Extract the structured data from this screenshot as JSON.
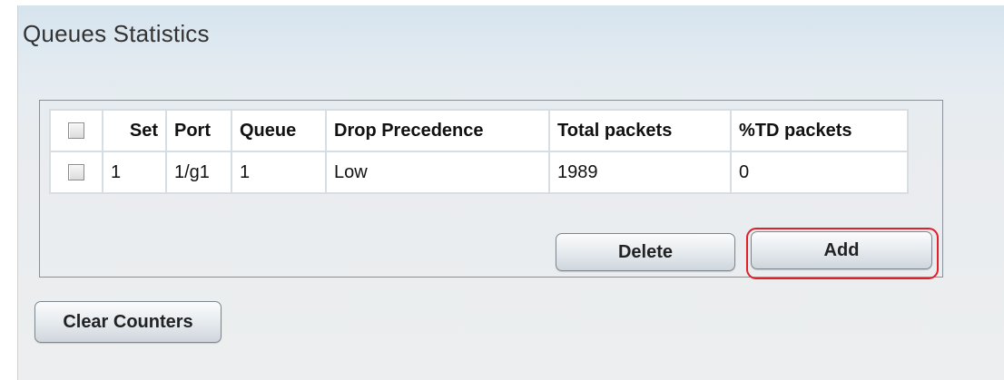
{
  "panel": {
    "title": "Queues Statistics"
  },
  "table": {
    "headers": {
      "set": "Set",
      "port": "Port",
      "queue": "Queue",
      "drop_precedence": "Drop Precedence",
      "total_packets": "Total packets",
      "td_packets": "%TD packets"
    },
    "rows": [
      {
        "checked": false,
        "set": "1",
        "port": "1/g1",
        "queue": "1",
        "drop_precedence": "Low",
        "total_packets": "1989",
        "td_packets": "0"
      }
    ]
  },
  "buttons": {
    "delete_label": "Delete",
    "add_label": "Add",
    "clear_counters_label": "Clear Counters"
  },
  "highlight": {
    "target": "Add",
    "color": "#e0202a"
  }
}
